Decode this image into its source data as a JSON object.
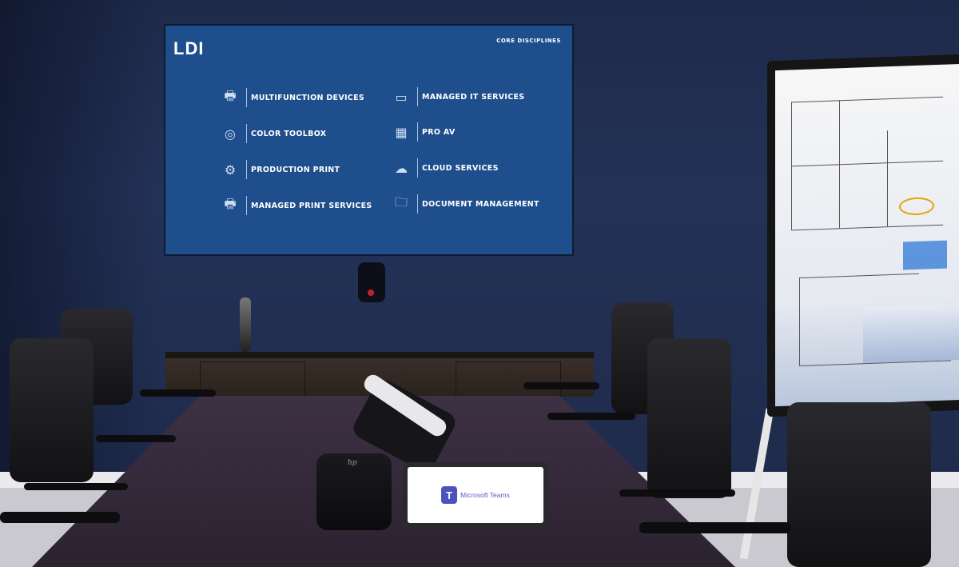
{
  "screen": {
    "logo": "LDI",
    "heading": "CORE DISCIPLINES",
    "items": [
      {
        "label": "MULTIFUNCTION DEVICES",
        "icon": "printer-icon"
      },
      {
        "label": "COLOR TOOLBOX",
        "icon": "cmyk-icon"
      },
      {
        "label": "PRODUCTION PRINT",
        "icon": "production-press-icon"
      },
      {
        "label": "MANAGED PRINT SERVICES",
        "icon": "printer-gear-icon"
      },
      {
        "label": "MANAGED IT SERVICES",
        "icon": "monitor-gear-icon"
      },
      {
        "label": "PRO AV",
        "icon": "presentation-icon"
      },
      {
        "label": "CLOUD SERVICES",
        "icon": "cloud-monitor-icon"
      },
      {
        "label": "DOCUMENT MANAGEMENT",
        "icon": "folder-icon"
      }
    ],
    "background": "#1e4e8c"
  },
  "devices": {
    "hub_brand": "hp",
    "tablet_app": "Microsoft Teams",
    "teams_letter": "T"
  }
}
